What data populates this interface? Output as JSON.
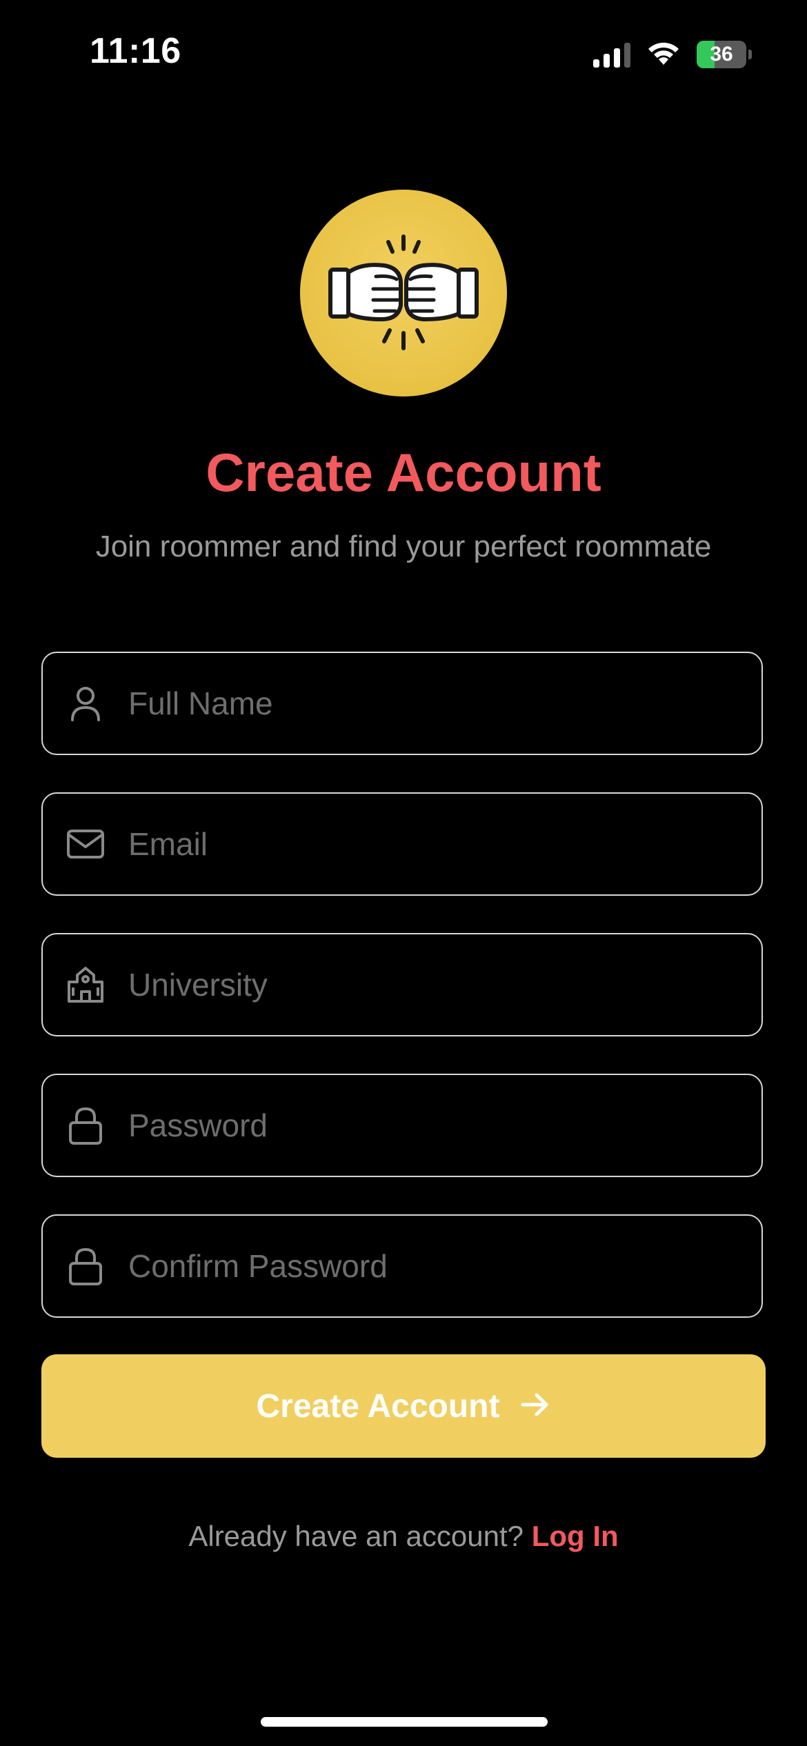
{
  "status_bar": {
    "time": "11:16",
    "battery_level": "36",
    "battery_fraction": 0.36,
    "battery_color": "#34c759"
  },
  "logo": {
    "icon": "fist-bump-icon",
    "background_color": "#e8c244"
  },
  "header": {
    "title": "Create Account",
    "subtitle": "Join roommer and find your perfect roommate",
    "title_color": "#f25a5e"
  },
  "form": {
    "fields": [
      {
        "icon": "user-icon",
        "placeholder": "Full Name",
        "value": ""
      },
      {
        "icon": "mail-icon",
        "placeholder": "Email",
        "value": ""
      },
      {
        "icon": "building-icon",
        "placeholder": "University",
        "value": ""
      },
      {
        "icon": "lock-icon",
        "placeholder": "Password",
        "value": ""
      },
      {
        "icon": "lock-icon",
        "placeholder": "Confirm Password",
        "value": ""
      }
    ],
    "submit": {
      "label": "Create Account",
      "icon": "arrow-right-icon",
      "color": "#f0cf60"
    }
  },
  "footer": {
    "prompt": "Already have an account?",
    "link_label": "Log In",
    "link_color": "#f25a5e"
  }
}
